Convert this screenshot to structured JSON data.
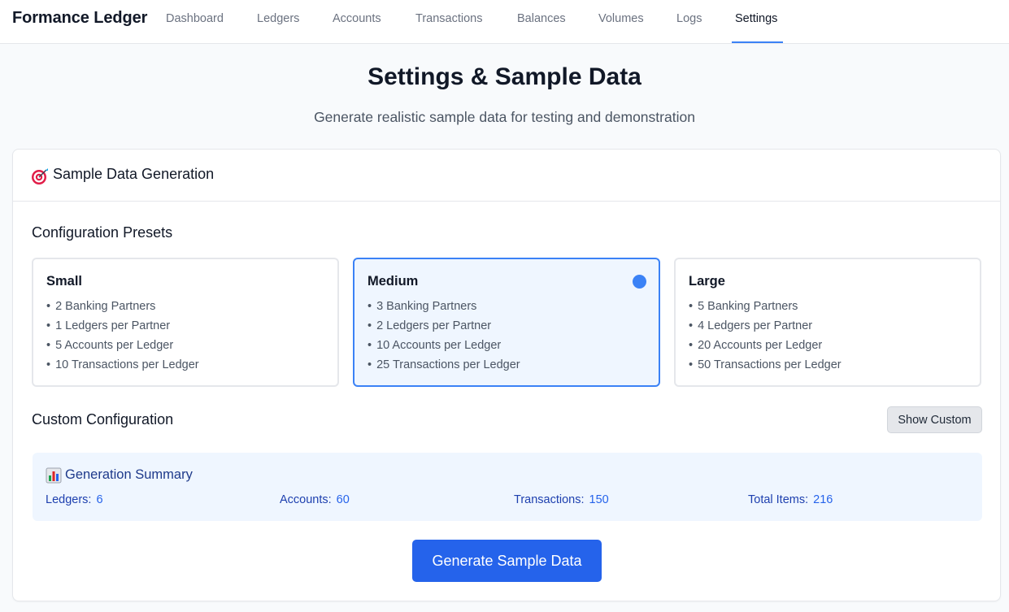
{
  "app": {
    "brand": "Formance Ledger"
  },
  "nav": {
    "items": [
      {
        "label": "Dashboard"
      },
      {
        "label": "Ledgers"
      },
      {
        "label": "Accounts"
      },
      {
        "label": "Transactions"
      },
      {
        "label": "Balances"
      },
      {
        "label": "Volumes"
      },
      {
        "label": "Logs"
      },
      {
        "label": "Settings"
      }
    ],
    "active": "Settings"
  },
  "page": {
    "title": "Settings & Sample Data",
    "subtitle": "Generate realistic sample data for testing and demonstration"
  },
  "card": {
    "icon": "target-icon",
    "title": "Sample Data Generation"
  },
  "presets": {
    "heading": "Configuration Presets",
    "selected": "Medium",
    "items": [
      {
        "name": "Small",
        "lines": [
          "2 Banking Partners",
          "1 Ledgers per Partner",
          "5 Accounts per Ledger",
          "10 Transactions per Ledger"
        ]
      },
      {
        "name": "Medium",
        "lines": [
          "3 Banking Partners",
          "2 Ledgers per Partner",
          "10 Accounts per Ledger",
          "25 Transactions per Ledger"
        ]
      },
      {
        "name": "Large",
        "lines": [
          "5 Banking Partners",
          "4 Ledgers per Partner",
          "20 Accounts per Ledger",
          "50 Transactions per Ledger"
        ]
      }
    ],
    "bullet": "•"
  },
  "custom": {
    "heading": "Custom Configuration",
    "button_label": "Show Custom"
  },
  "summary": {
    "icon": "bar-chart-icon",
    "title": "Generation Summary",
    "stats": [
      {
        "label": "Ledgers:",
        "value": "6"
      },
      {
        "label": "Accounts:",
        "value": "60"
      },
      {
        "label": "Transactions:",
        "value": "150"
      },
      {
        "label": "Total Items:",
        "value": "216"
      }
    ]
  },
  "actions": {
    "generate_label": "Generate Sample Data"
  },
  "colors": {
    "accent": "#3b82f6",
    "primary_button": "#2563eb",
    "selected_bg": "#eff6ff",
    "summary_text": "#1e40af"
  }
}
